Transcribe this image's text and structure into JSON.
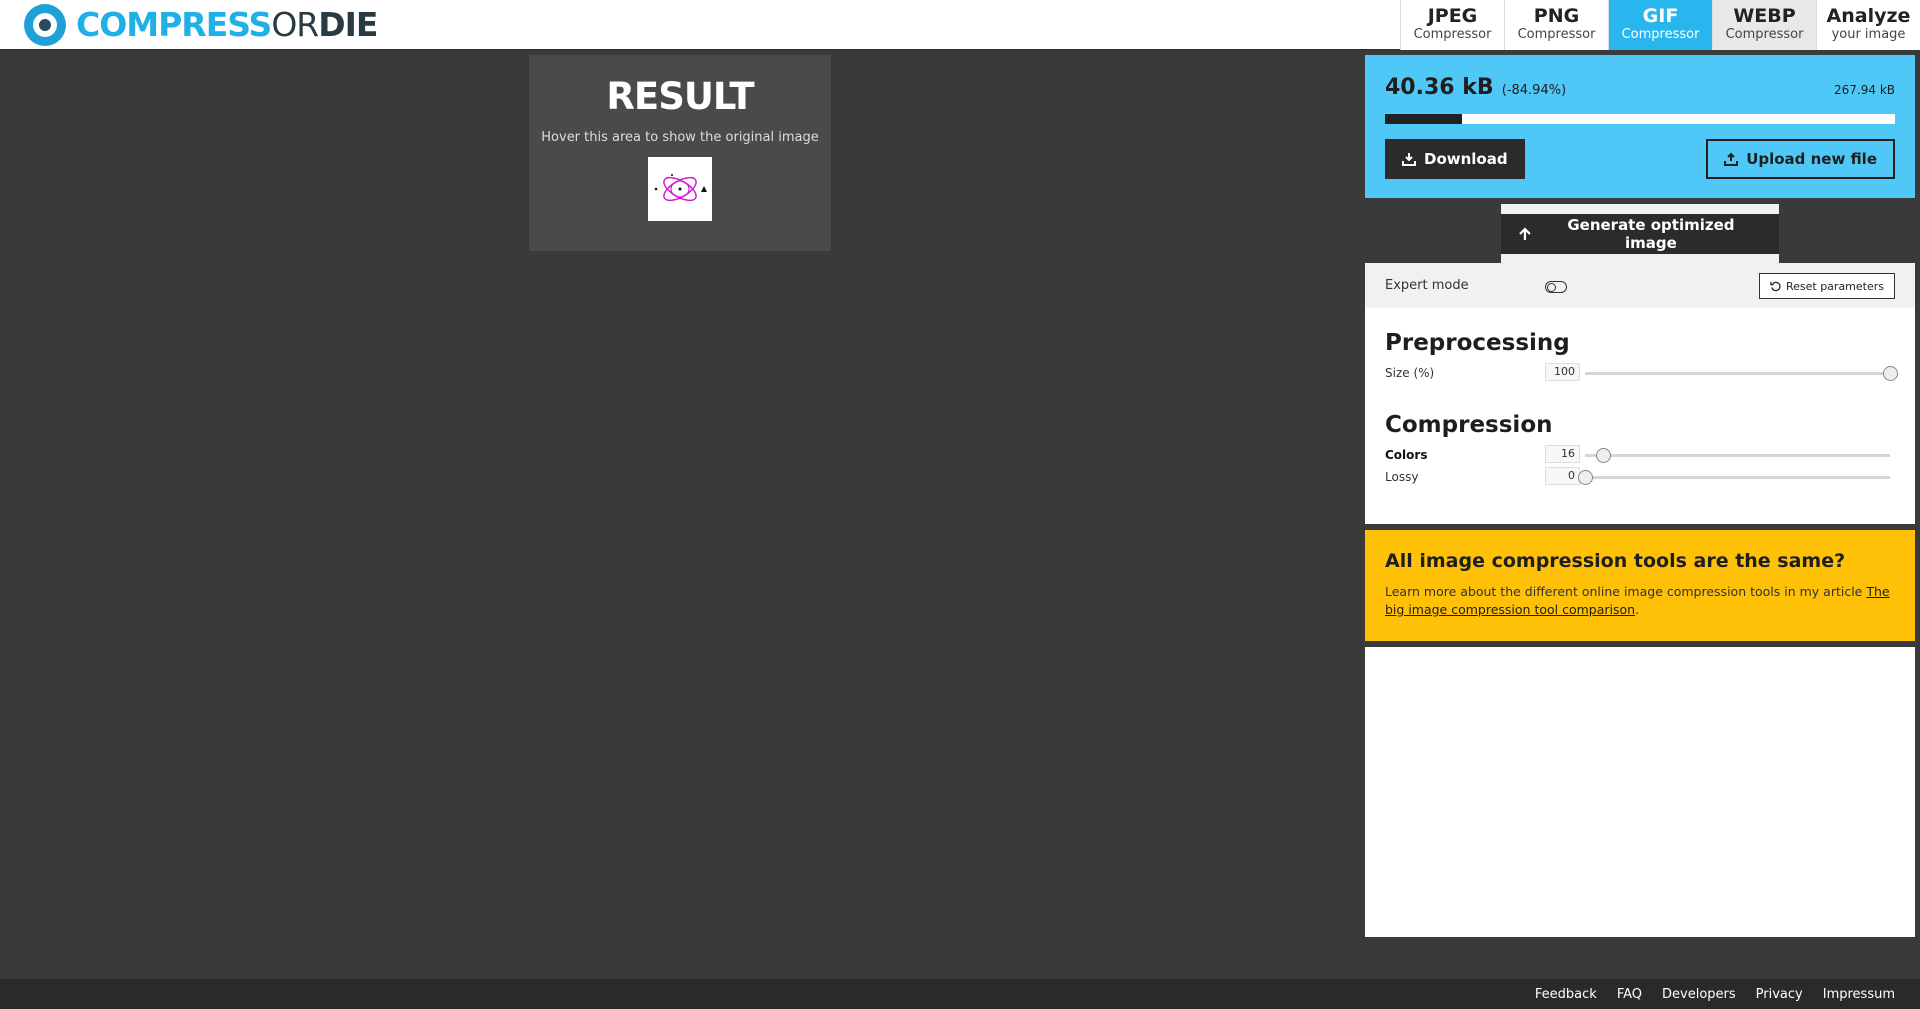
{
  "header": {
    "logo": {
      "part1": "COMPRESS",
      "part2": "OR",
      "part3": "DIE"
    },
    "tabs": [
      {
        "title": "JPEG",
        "subtitle": "Compressor",
        "state": "normal"
      },
      {
        "title": "PNG",
        "subtitle": "Compressor",
        "state": "normal"
      },
      {
        "title": "GIF",
        "subtitle": "Compressor",
        "state": "active"
      },
      {
        "title": "WEBP",
        "subtitle": "Compressor",
        "state": "hover"
      },
      {
        "title": "Analyze",
        "subtitle": "your image",
        "state": "normal"
      }
    ]
  },
  "result": {
    "title": "RESULT",
    "hint": "Hover this area to show the original image"
  },
  "stats": {
    "new_size": "40.36 kB",
    "percent": "(-84.94%)",
    "original_size": "267.94 kB",
    "progress_fraction": 0.15,
    "download_label": "Download",
    "upload_label": "Upload new file"
  },
  "generate": {
    "label": "Generate optimized image"
  },
  "params": {
    "expert_mode_label": "Expert mode",
    "reset_label": "Reset parameters",
    "preprocessing_title": "Preprocessing",
    "size_label": "Size (%)",
    "size_value": "100",
    "size_fraction": 1.0,
    "compression_title": "Compression",
    "colors_label": "Colors",
    "colors_value": "16",
    "colors_fraction": 0.06,
    "lossy_label": "Lossy",
    "lossy_value": "0",
    "lossy_fraction": 0.0
  },
  "promo": {
    "title": "All image compression tools are the same?",
    "text": "Learn more about the different online image compression tools in my article ",
    "link": "The big image compression tool comparison",
    "end": "."
  },
  "footer": {
    "links": [
      "Feedback",
      "FAQ",
      "Developers",
      "Privacy",
      "Impressum"
    ]
  },
  "colors": {
    "accent": "#29b6ee",
    "stats_bg": "#4fc8f7",
    "promo_bg": "#ffc107",
    "page_bg": "#3a3a3a"
  }
}
